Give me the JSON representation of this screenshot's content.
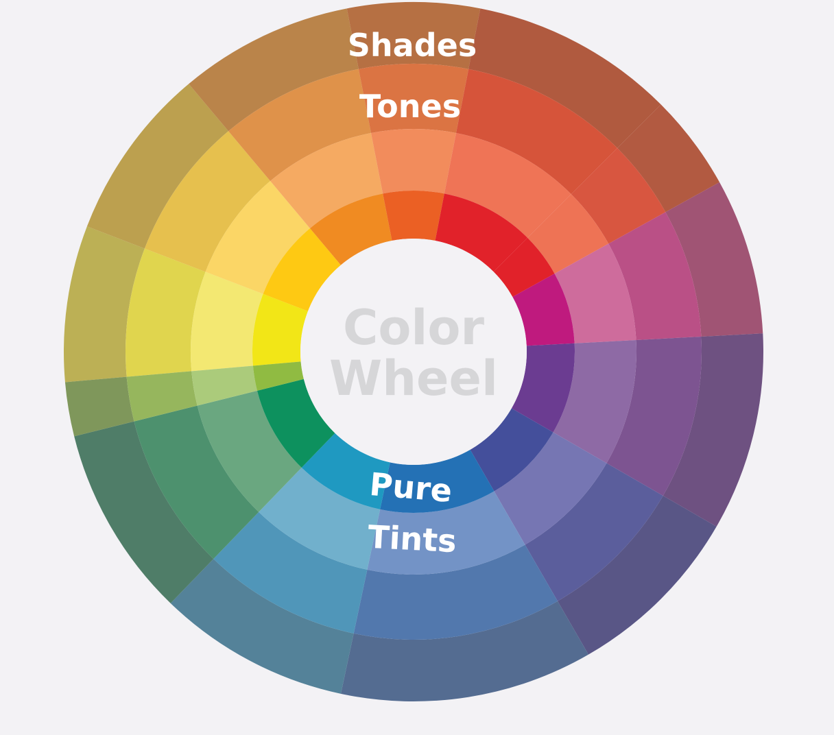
{
  "title": {
    "line1": "Color",
    "line2": "Wheel"
  },
  "labels": {
    "shades": "Shades",
    "tones": "Tones",
    "pure": "Pure",
    "tints": "Tints"
  },
  "rings": [
    {
      "name": "shades",
      "colors": [
        "#bcb055",
        "#bca04f",
        "#ba844a",
        "#b67043",
        "#b05a3f",
        "#b25a41",
        "#a05474",
        "#6e5181",
        "#595686",
        "#546c91",
        "#548299",
        "#4f7d68",
        "#7f975b"
      ]
    },
    {
      "name": "tones",
      "colors": [
        "#e0d54e",
        "#e6c04e",
        "#df924a",
        "#db7443",
        "#d6543a",
        "#d85640",
        "#ba5086",
        "#7d5491",
        "#5b5e9c",
        "#5278ad",
        "#5096b9",
        "#4d916e",
        "#96b65d"
      ]
    },
    {
      "name": "tints",
      "colors": [
        "#f3e872",
        "#fbd666",
        "#f5aa62",
        "#f28c5c",
        "#ef7456",
        "#ee7355",
        "#ce6c9c",
        "#8e6aa5",
        "#7676b3",
        "#7393c6",
        "#71b0cc",
        "#6aa780",
        "#abcb7b"
      ]
    },
    {
      "name": "pure",
      "colors": [
        "#f2e617",
        "#fec913",
        "#f08b22",
        "#eb6024",
        "#e1222a",
        "#e1222a",
        "#bf1a7e",
        "#6b3c91",
        "#444f9b",
        "#2471b5",
        "#1f99c1",
        "#0d915e",
        "#90bb42"
      ]
    }
  ]
}
